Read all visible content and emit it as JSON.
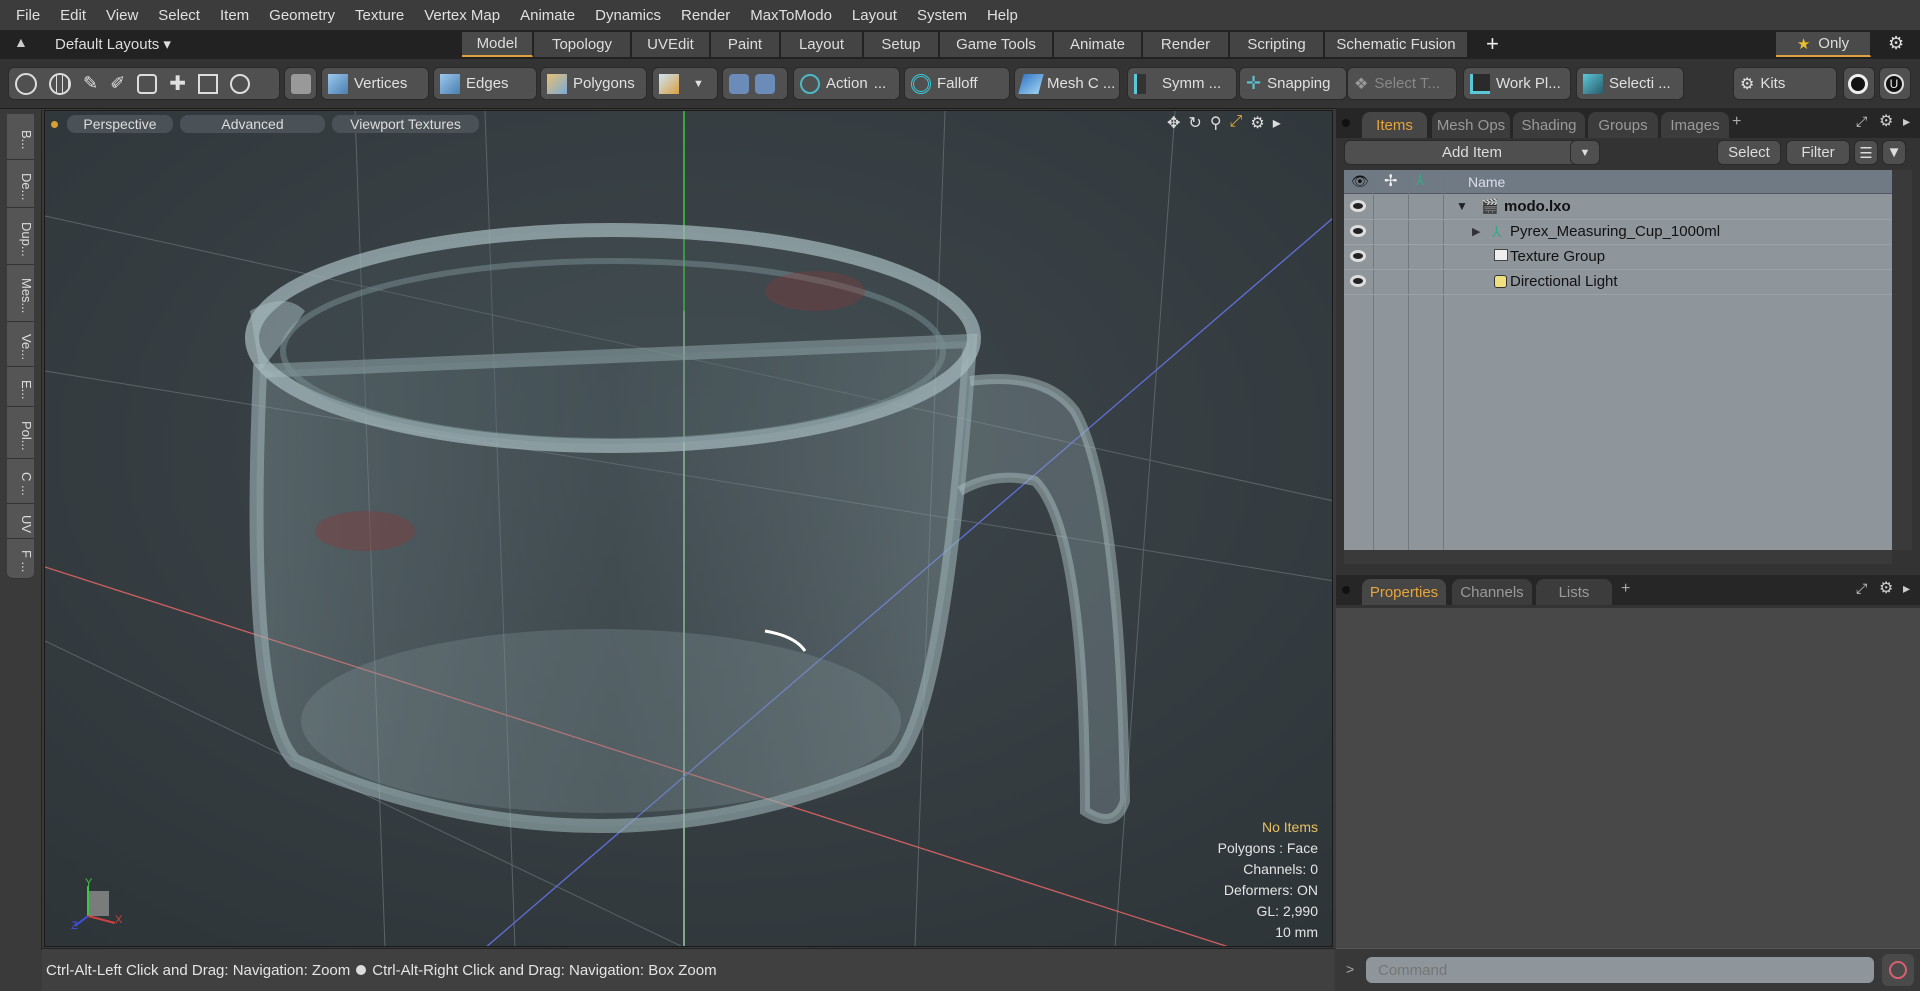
{
  "menu": [
    "File",
    "Edit",
    "View",
    "Select",
    "Item",
    "Geometry",
    "Texture",
    "Vertex Map",
    "Animate",
    "Dynamics",
    "Render",
    "MaxToModo",
    "Layout",
    "System",
    "Help"
  ],
  "layout_selector": "Default Layouts ▾",
  "layout_tabs": [
    "Model",
    "Topology",
    "UVEdit",
    "Paint",
    "Layout",
    "Setup",
    "Game Tools",
    "Animate",
    "Render",
    "Scripting",
    "Schematic Fusion"
  ],
  "layout_add": "+",
  "only_label": "Only",
  "toolbar": {
    "vertices": "Vertices",
    "edges": "Edges",
    "polygons": "Polygons",
    "action": "Action",
    "action_more": "...",
    "falloff": "Falloff",
    "mesh": "Mesh C ...",
    "symm": "Symm ...",
    "snapping": "Snapping",
    "select_t": "Select T...",
    "workplane": "Work Pl...",
    "selection": "Selecti ...",
    "kits": "Kits"
  },
  "left_tools": [
    "B...",
    "De...",
    "Dup...",
    "Mes...",
    "Ve...",
    "E...",
    "Pol...",
    "C ...",
    "UV",
    "F ..."
  ],
  "viewport": {
    "perspective": "Perspective",
    "advanced": "Advanced",
    "textures": "Viewport Textures",
    "info": {
      "items": "No Items",
      "polygons": "Polygons : Face",
      "channels": "Channels: 0",
      "deformers": "Deformers: ON",
      "gl": "GL: 2,990",
      "unit": "10 mm"
    },
    "axis_y": "Y",
    "axis_x": "X",
    "axis_z": "Z"
  },
  "status": {
    "left": "Ctrl-Alt-Left Click and Drag: Navigation: Zoom",
    "right": "Ctrl-Alt-Right Click and Drag: Navigation: Box Zoom"
  },
  "items_panel": {
    "tabs": [
      "Items",
      "Mesh Ops",
      "Shading",
      "Groups",
      "Images"
    ],
    "add": "+",
    "add_item": "Add Item",
    "select": "Select",
    "filter": "Filter",
    "col_name": "Name",
    "rows": [
      {
        "name": "modo.lxo"
      },
      {
        "name": "Pyrex_Measuring_Cup_1000ml"
      },
      {
        "name": "Texture Group"
      },
      {
        "name": "Directional Light"
      }
    ]
  },
  "props_panel": {
    "tabs": [
      "Properties",
      "Channels",
      "Lists"
    ],
    "add": "+"
  },
  "command": {
    "prompt": ">",
    "placeholder": "Command"
  },
  "colors": {
    "accent": "#e8a43a",
    "viewport_bg": "#343c41"
  }
}
